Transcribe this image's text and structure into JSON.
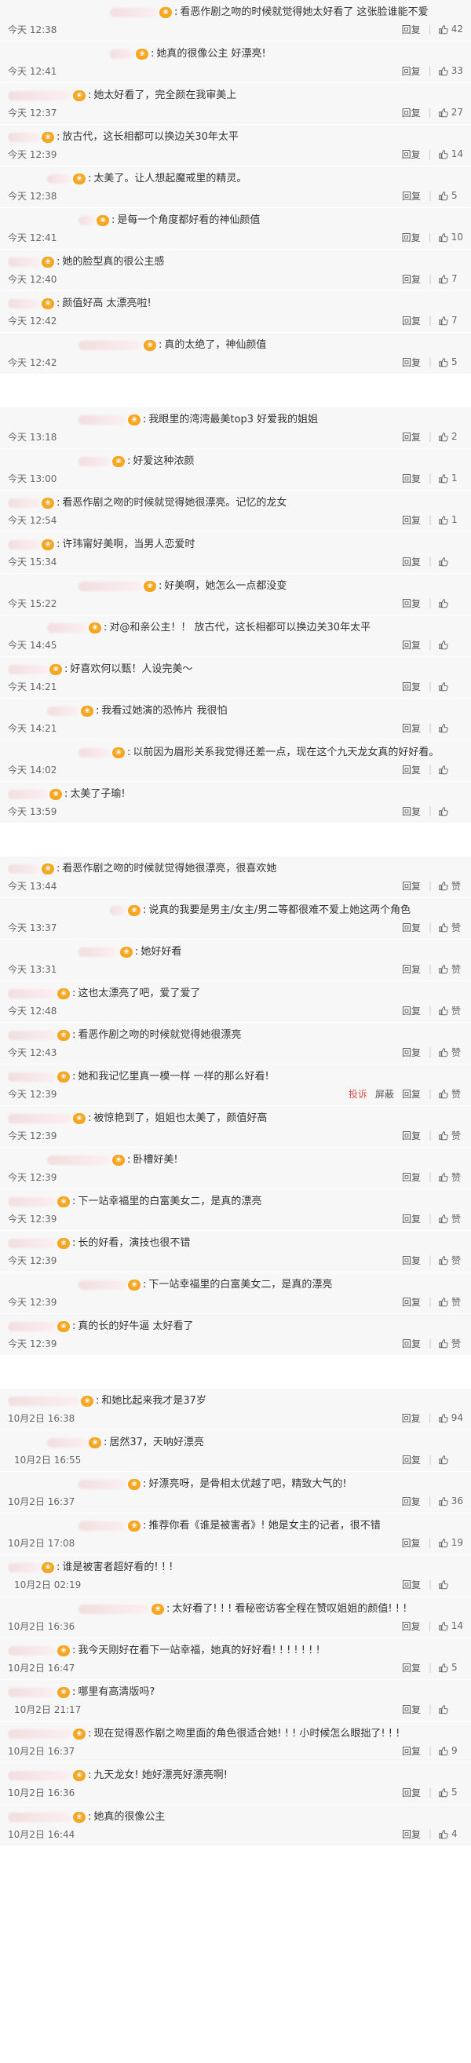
{
  "actions": {
    "reply": "回复",
    "like_zero": "赞",
    "report": "投诉",
    "hide": "屏蔽"
  },
  "sections": [
    {
      "comments": [
        {
          "text": "看恶作剧之吻的时候就觉得她太好看了 这张脸谁能不爱",
          "time": "今天 12:38",
          "likes": "42",
          "indent": 3,
          "name_w": 60
        },
        {
          "text": "她真的很像公主 好漂亮!",
          "time": "今天 12:41",
          "likes": "33",
          "indent": 3,
          "name_w": 30
        },
        {
          "text": "她太好看了，完全颜在我审美上",
          "time": "今天 12:37",
          "likes": "27",
          "indent": 0,
          "name_w": 80
        },
        {
          "text": "放古代，这长相都可以换边关30年太平",
          "time": "今天 12:39",
          "likes": "14",
          "indent": 0,
          "name_w": 40
        },
        {
          "text": "太美了。让人想起魔戒里的精灵。",
          "time": "今天 12:38",
          "likes": "5",
          "indent": 1,
          "name_w": 30
        },
        {
          "text": "是每一个角度都好看的神仙颜值",
          "time": "今天 12:41",
          "likes": "10",
          "indent": 2,
          "name_w": 20
        },
        {
          "text": "她的脸型真的很公主感",
          "time": "今天 12:40",
          "likes": "7",
          "indent": 0,
          "name_w": 40
        },
        {
          "text": "颜值好高 太漂亮啦!",
          "time": "今天 12:42",
          "likes": "7",
          "indent": 0,
          "name_w": 40
        },
        {
          "text": "真的太绝了，神仙颜值",
          "time": "今天 12:42",
          "likes": "5",
          "indent": 2,
          "name_w": 80
        }
      ]
    },
    {
      "comments": [
        {
          "text": "我眼里的湾湾最美top3 好爱我的姐姐",
          "time": "今天 13:18",
          "likes": "2",
          "indent": 2,
          "name_w": 60
        },
        {
          "text": "好爱这种浓颜",
          "time": "今天 13:00",
          "likes": "1",
          "indent": 2,
          "name_w": 40
        },
        {
          "text": "看恶作剧之吻的时候就觉得她很漂亮。记忆的龙女",
          "time": "今天 12:54",
          "likes": "1",
          "indent": 0,
          "name_w": 40
        },
        {
          "text": "许玮甯好美啊，当男人恋爱时",
          "time": "今天 15:34",
          "likes": "",
          "indent": 0,
          "name_w": 40
        },
        {
          "text": "好美啊，她怎么一点都没变",
          "time": "今天 15:22",
          "likes": "",
          "indent": 2,
          "name_w": 80
        },
        {
          "text": "对@和亲公主！！ 放古代，这长相都可以换边关30年太平",
          "time": "今天 14:45",
          "likes": "",
          "indent": 1,
          "name_w": 50
        },
        {
          "text": "好喜欢何以甄！人设完美～",
          "time": "今天 14:21",
          "likes": "",
          "indent": 0,
          "name_w": 50
        },
        {
          "text": "我看过她演的恐怖片 我很怕",
          "time": "今天 14:21",
          "likes": "",
          "indent": 1,
          "name_w": 40
        },
        {
          "text": "以前因为眉形关系我觉得还差一点，现在这个九天龙女真的好好看。",
          "time": "今天 14:02",
          "likes": "",
          "indent": 2,
          "name_w": 40
        },
        {
          "text": "太美了子瑜!",
          "time": "今天 13:59",
          "likes": "",
          "indent": 0,
          "name_w": 50
        }
      ]
    },
    {
      "comments": [
        {
          "text": "看恶作剧之吻的时候就觉得她很漂亮，很喜欢她",
          "time": "今天 13:44",
          "likes": "赞",
          "indent": 0,
          "name_w": 40
        },
        {
          "text": "说真的我要是男主/女主/男二等都很难不爱上她这两个角色",
          "time": "今天 13:37",
          "likes": "赞",
          "indent": 3,
          "name_w": 20
        },
        {
          "text": "她好好看",
          "time": "今天 13:31",
          "likes": "赞",
          "indent": 2,
          "name_w": 50
        },
        {
          "text": "这也太漂亮了吧，爱了爱了",
          "time": "今天 12:48",
          "likes": "赞",
          "indent": 0,
          "name_w": 60
        },
        {
          "text": "看恶作剧之吻的时候就觉得她很漂亮",
          "time": "今天 12:43",
          "likes": "赞",
          "indent": 0,
          "name_w": 60
        },
        {
          "text": "她和我记忆里真一模一样 一样的那么好看!",
          "time": "今天 12:39",
          "likes": "赞",
          "indent": 0,
          "name_w": 60,
          "report": true
        },
        {
          "text": "被惊艳到了，姐姐也太美了，颜值好高",
          "time": "今天 12:39",
          "likes": "赞",
          "indent": 0,
          "name_w": 80
        },
        {
          "text": "卧槽好美!",
          "time": "今天 12:39",
          "likes": "赞",
          "indent": 1,
          "name_w": 80
        },
        {
          "text": "下一站幸福里的白富美女二，是真的漂亮",
          "time": "今天 12:39",
          "likes": "赞",
          "indent": 0,
          "name_w": 60
        },
        {
          "text": "长的好看，演技也很不错",
          "time": "今天 12:39",
          "likes": "赞",
          "indent": 0,
          "name_w": 60
        },
        {
          "text": "下一站幸福里的白富美女二，是真的漂亮",
          "time": "今天 12:39",
          "likes": "赞",
          "indent": 2,
          "name_w": 60
        },
        {
          "text": "真的长的好牛逼 太好看了",
          "time": "今天 12:39",
          "likes": "赞",
          "indent": 0,
          "name_w": 60
        }
      ]
    },
    {
      "comments": [
        {
          "text": "和她比起来我才是37岁",
          "time": "10月2日 16:38",
          "likes": "94",
          "indent": 0,
          "name_w": 90
        },
        {
          "text": "居然37，天呐好漂亮",
          "time": "10月2日 16:55",
          "likes": "",
          "indent": 1,
          "name_w": 50,
          "time_indent": true
        },
        {
          "text": "好漂亮呀，是骨相太优越了吧，精致大气的!",
          "time": "10月2日 16:37",
          "likes": "36",
          "indent": 2,
          "name_w": 60
        },
        {
          "text": "推荐你看《谁是被害者》! 她是女主的记者，很不错",
          "time": "10月2日 17:08",
          "likes": "19",
          "indent": 2,
          "name_w": 60
        },
        {
          "text": "谁是被害者超好看的! ! !",
          "time": "10月2日 02:19",
          "likes": "",
          "indent": 0,
          "name_w": 40,
          "time_indent": true
        },
        {
          "text": "太好看了! ! ! 看秘密访客全程在赞叹姐姐的颜值! ! !",
          "time": "10月2日 16:36",
          "likes": "14",
          "indent": 2,
          "name_w": 90
        },
        {
          "text": "我今天刚好在看下一站幸福，她真的好好看! ! ! ! ! ! !",
          "time": "10月2日 16:47",
          "likes": "5",
          "indent": 0,
          "name_w": 60
        },
        {
          "text": "哪里有高清版吗?",
          "time": "10月2日 21:17",
          "likes": "",
          "indent": 0,
          "name_w": 60,
          "time_indent": true
        },
        {
          "text": "现在觉得恶作剧之吻里面的角色很适合她! ! ! 小时候怎么眼拙了! ! !",
          "time": "10月2日 16:37",
          "likes": "9",
          "indent": 0,
          "name_w": 80
        },
        {
          "text": "九天龙女! 她好漂亮好漂亮啊!",
          "time": "10月2日 16:36",
          "likes": "5",
          "indent": 0,
          "name_w": 80
        },
        {
          "text": "她真的很像公主",
          "time": "10月2日 16:44",
          "likes": "4",
          "indent": 0,
          "name_w": 80
        }
      ]
    }
  ]
}
